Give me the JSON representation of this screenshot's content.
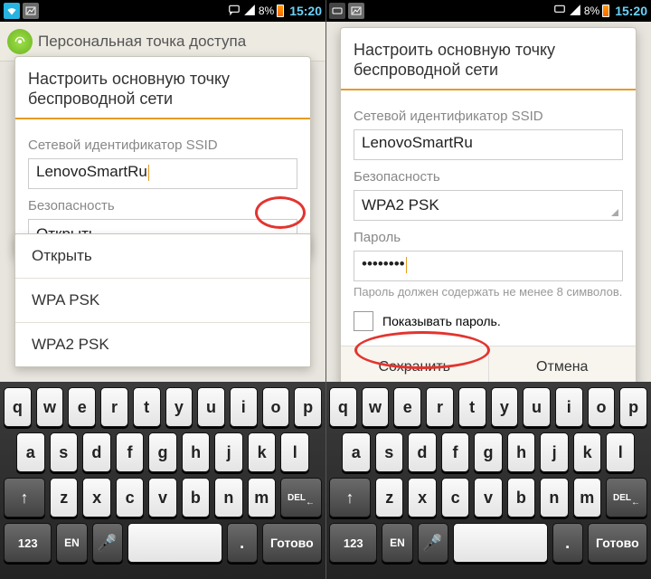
{
  "statusbar": {
    "battery_pct": "8%",
    "clock": "15:20"
  },
  "left": {
    "page_title": "Персональная точка доступа",
    "dialog_title": "Настроить основную точку беспроводной сети",
    "ssid_label": "Сетевой идентификатор SSID",
    "ssid_value": "LenovoSmartRu",
    "security_label": "Безопасность",
    "security_value": "Открыть",
    "options": {
      "open": "Открыть",
      "wpa": "WPA PSK",
      "wpa2": "WPA2 PSK"
    }
  },
  "right": {
    "dialog_title": "Настроить основную точку беспроводной сети",
    "ssid_label": "Сетевой идентификатор SSID",
    "ssid_value": "LenovoSmartRu",
    "security_label": "Безопасность",
    "security_value": "WPA2 PSK",
    "password_label": "Пароль",
    "password_value": "••••••••",
    "password_hint": "Пароль должен содержать не менее 8 символов.",
    "show_password": "Показывать пароль.",
    "save": "Сохранить",
    "cancel": "Отмена"
  },
  "keyboard": {
    "row1": [
      "q",
      "w",
      "e",
      "r",
      "t",
      "y",
      "u",
      "i",
      "o",
      "p"
    ],
    "row2": [
      "a",
      "s",
      "d",
      "f",
      "g",
      "h",
      "j",
      "k",
      "l"
    ],
    "shift": "↑",
    "row3": [
      "z",
      "x",
      "c",
      "v",
      "b",
      "n",
      "m"
    ],
    "del": "DEL",
    "num": "123",
    "lang": "EN",
    "mic": "🎤",
    "space": " ",
    "dot": ".",
    "go": "Готово"
  }
}
